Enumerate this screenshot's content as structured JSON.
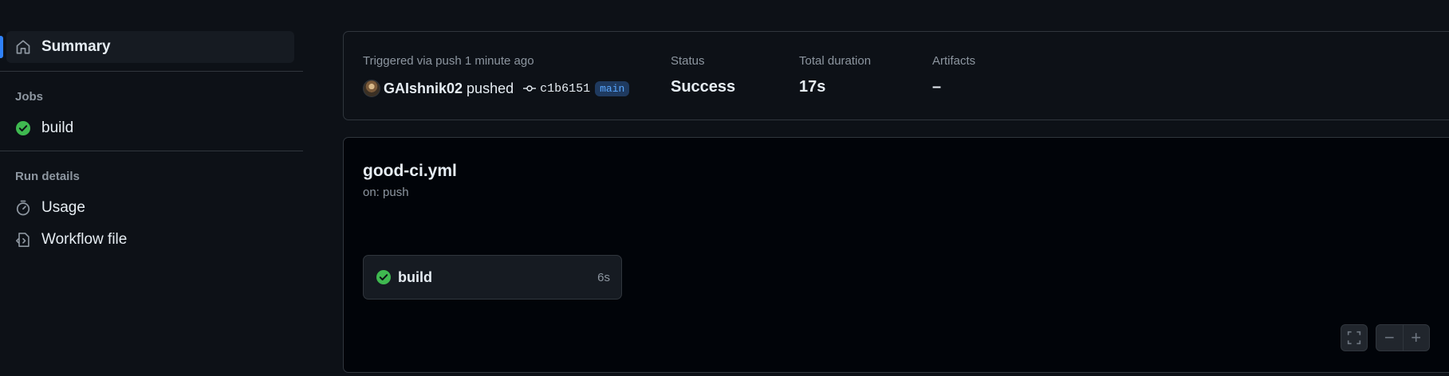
{
  "sidebar": {
    "summary_label": "Summary",
    "jobs_heading": "Jobs",
    "jobs": [
      {
        "label": "build",
        "status": "success"
      }
    ],
    "run_details_heading": "Run details",
    "usage_label": "Usage",
    "workflow_file_label": "Workflow file"
  },
  "summary": {
    "trigger_text": "Triggered via push 1 minute ago",
    "user": "GAIshnik02",
    "action": "pushed",
    "commit": "c1b6151",
    "branch": "main",
    "status_label": "Status",
    "status_value": "Success",
    "duration_label": "Total duration",
    "duration_value": "17s",
    "artifacts_label": "Artifacts",
    "artifacts_value": "–"
  },
  "workflow": {
    "file": "good-ci.yml",
    "trigger": "on: push",
    "jobs": [
      {
        "name": "build",
        "duration": "6s",
        "status": "success"
      }
    ]
  },
  "colors": {
    "background": "#0d1117",
    "success": "#3fb950",
    "accent": "#2f81f7",
    "border": "#30363d",
    "muted_text": "#8d96a0"
  },
  "icons": {
    "summary": "home-icon",
    "job_status": "check-circle-icon",
    "usage": "stopwatch-icon",
    "workflow_file": "file-code-icon",
    "commit": "git-commit-icon",
    "fullscreen": "fullscreen-icon",
    "zoom_out": "minus-icon",
    "zoom_in": "plus-icon"
  }
}
